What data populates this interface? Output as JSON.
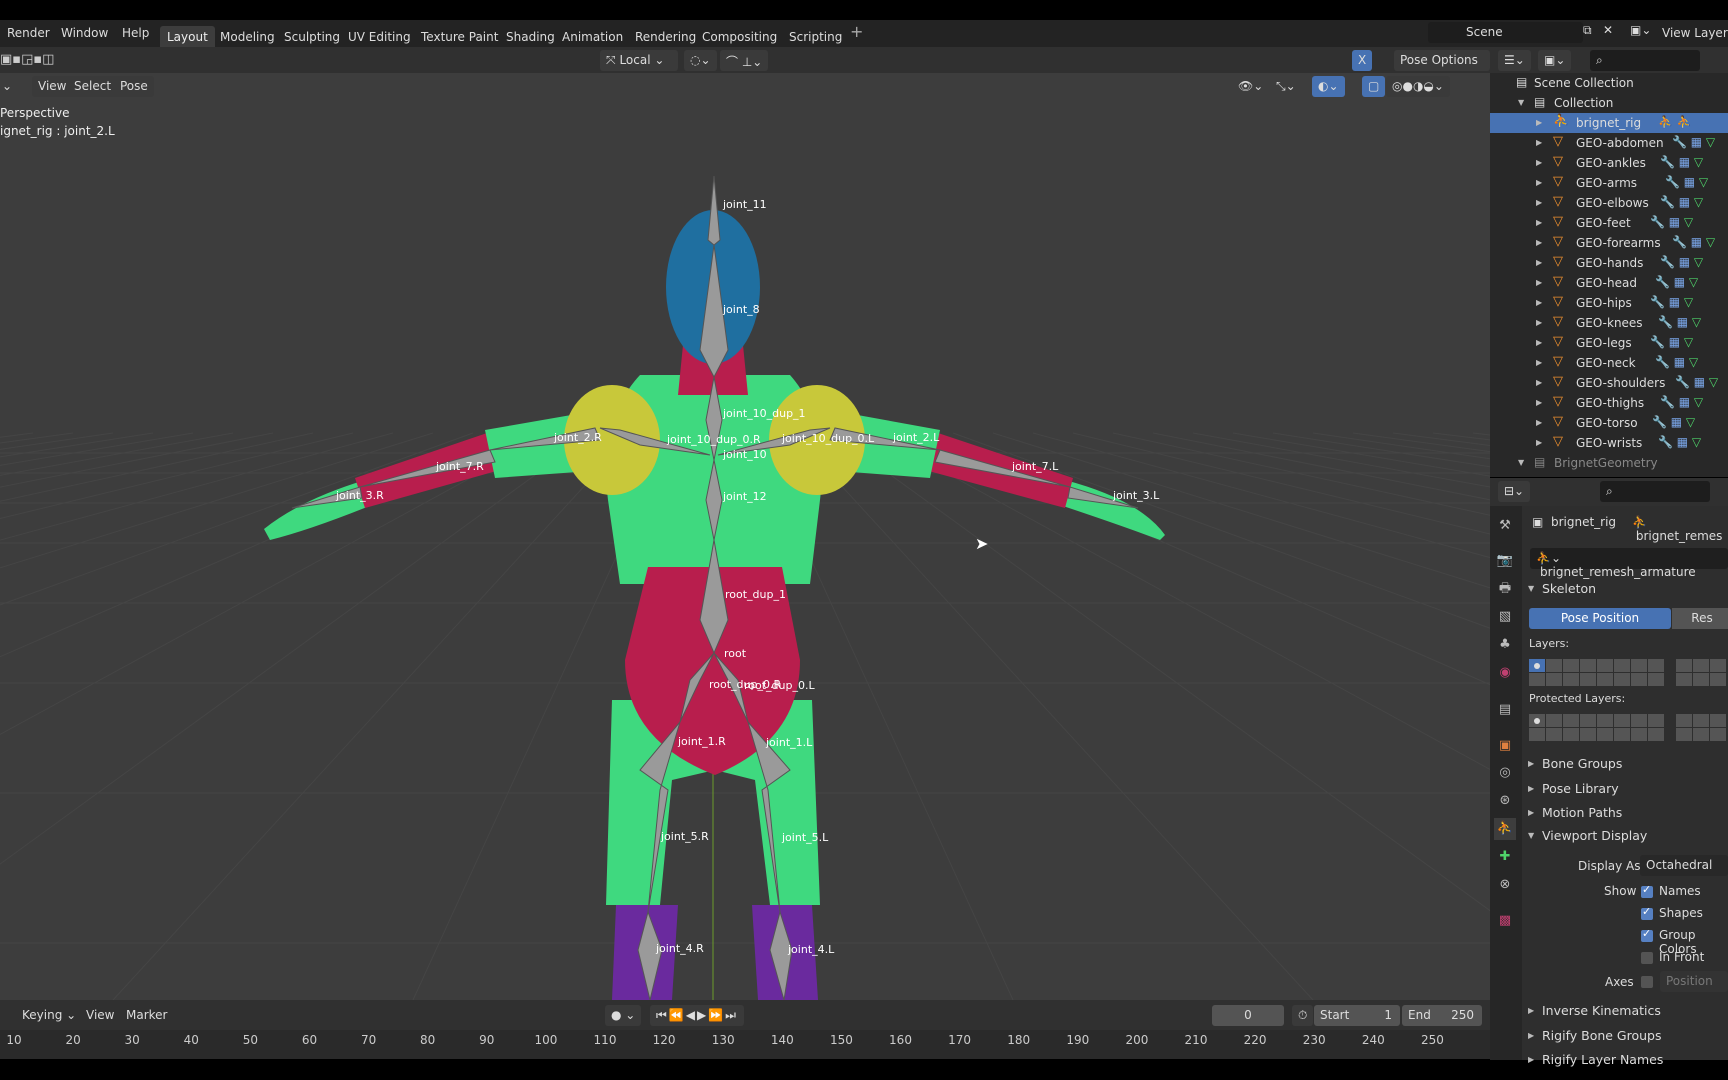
{
  "menu": {
    "items": [
      "Render",
      "Window",
      "Help"
    ]
  },
  "workspaces": [
    "Layout",
    "Modeling",
    "Sculpting",
    "UV Editing",
    "Texture Paint",
    "Shading",
    "Animation",
    "Rendering",
    "Compositing",
    "Scripting"
  ],
  "workspace_active": "Layout",
  "scene": {
    "name": "Scene",
    "view_layer": "View Layer"
  },
  "tool_header": {
    "orientation": "Local",
    "pose_options": "Pose Options"
  },
  "viewport_header": {
    "items": [
      "View",
      "Select",
      "Pose"
    ]
  },
  "viewport": {
    "perspective": "Perspective",
    "active": "ignet_rig : joint_2.L"
  },
  "bones": [
    "joint_11",
    "joint_8",
    "joint_10_dup_1",
    "joint_10_dup_0.R",
    "joint_10",
    "joint_10_dup_0.L",
    "joint_2.R",
    "joint_2.L",
    "joint_7.R",
    "joint_7.L",
    "joint_3.R",
    "joint_3.L",
    "joint_12",
    "root_dup_1",
    "root",
    "root_dup_0.R",
    "root_dup_0.L",
    "joint_1.R",
    "joint_1.L",
    "joint_5.R",
    "joint_5.L",
    "joint_4.R",
    "joint_4.L"
  ],
  "colors": {
    "head": "#1f6fa0",
    "body": "#3fd97f",
    "shoulder": "#c8c83a",
    "limb_red": "#b81e4d",
    "feet": "#6a2a9e",
    "accent": "#4772b3"
  },
  "outliner": {
    "scene_collection": "Scene Collection",
    "collection": "Collection",
    "items": [
      "brignet_rig",
      "GEO-abdomen",
      "GEO-ankles",
      "GEO-arms",
      "GEO-elbows",
      "GEO-feet",
      "GEO-forearms",
      "GEO-hands",
      "GEO-head",
      "GEO-hips",
      "GEO-knees",
      "GEO-legs",
      "GEO-neck",
      "GEO-shoulders",
      "GEO-thighs",
      "GEO-torso",
      "GEO-wrists"
    ],
    "last": "BrignetGeometry"
  },
  "properties": {
    "object": "brignet_rig",
    "data": "brignet_remes",
    "armature": "brignet_remesh_armature",
    "skeleton": "Skeleton",
    "pose_position": "Pose Position",
    "rest_position": "Res",
    "layers": "Layers:",
    "protected_layers": "Protected Layers:",
    "sections_closed": [
      "Bone Groups",
      "Pose Library",
      "Motion Paths"
    ],
    "viewport_display": "Viewport Display",
    "display_as_label": "Display As",
    "display_as": "Octahedral",
    "show_label": "Show",
    "show": [
      {
        "label": "Names",
        "checked": true
      },
      {
        "label": "Shapes",
        "checked": true
      },
      {
        "label": "Group Colors",
        "checked": true
      },
      {
        "label": "In Front",
        "checked": false
      }
    ],
    "axes_label": "Axes",
    "axes_position": "Position",
    "sections_after": [
      "Inverse Kinematics",
      "Rigify Bone Groups",
      "Rigify Layer Names"
    ]
  },
  "timeline": {
    "keying": "Keying",
    "view": "View",
    "marker": "Marker",
    "current": "0",
    "start_label": "Start",
    "start": "1",
    "end_label": "End",
    "end": "250",
    "ruler": [
      "10",
      "20",
      "30",
      "40",
      "50",
      "60",
      "70",
      "80",
      "90",
      "100",
      "110",
      "120",
      "130",
      "140",
      "150",
      "160",
      "170",
      "180",
      "190",
      "200",
      "210",
      "220",
      "230",
      "240",
      "250"
    ]
  }
}
